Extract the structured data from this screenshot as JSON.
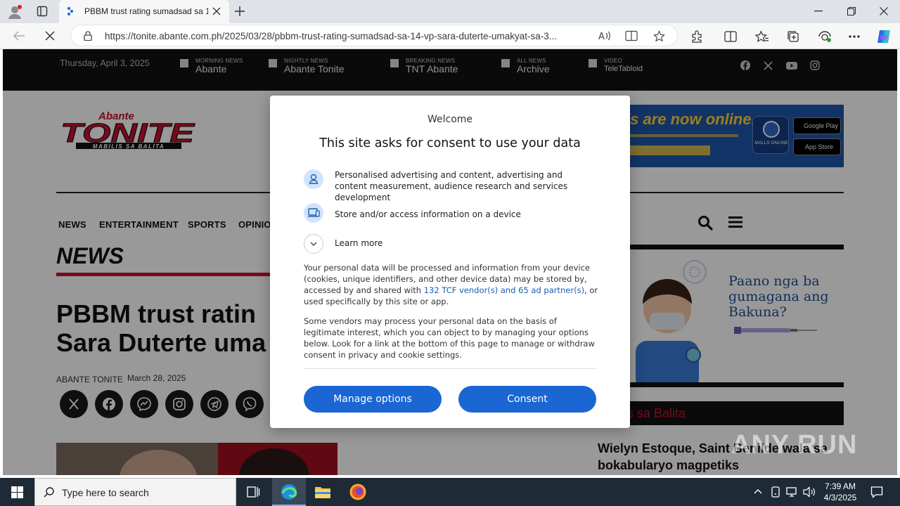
{
  "browser": {
    "tab_title": "PBBM trust rating sumadsad sa 1",
    "url": "https://tonite.abante.com.ph/2025/03/28/pbbm-trust-rating-sumadsad-sa-14-vp-sara-duterte-umakyat-sa-3..."
  },
  "site": {
    "date": "Thursday, April 3, 2025",
    "topnav": [
      {
        "small": "MORNING NEWS",
        "big": "Abante"
      },
      {
        "small": "NIGHTLY NEWS",
        "big": "Abante Tonite"
      },
      {
        "small": "BREAKING NEWS",
        "big": "TNT Abante"
      },
      {
        "small": "ALL NEWS",
        "big": "Archive"
      },
      {
        "small": "VIDEO",
        "big": "TeleTabloid"
      }
    ],
    "logo": {
      "top": "Abante",
      "main": "TONITE",
      "tagline": "MABILIS SA BALITA"
    },
    "banner_top_text": "ls are now online.",
    "banner_top_badge": "MALLS ONLINE",
    "store1": "Google Play",
    "store2": "App Store",
    "nav": [
      "NEWS",
      "ENTERTAINMENT",
      "SPORTS",
      "OPINIO"
    ],
    "section": "NEWS",
    "headline_line1": "PBBM trust ratin",
    "headline_line2": "Sara Duterte uma",
    "author": "ABANTE TONITE",
    "article_date": "March 28, 2025",
    "side_banner_text": "Paano nga ba gumagana ang Bakuna?",
    "side_bar_text": "lis sa Balita",
    "side_headline": "Wielyn Estoque, Saint Benilde wala sa bokabularyo magpetiks"
  },
  "consent": {
    "welcome": "Welcome",
    "title": "This site asks for consent to use your data",
    "purpose1": "Personalised advertising and content, advertising and content measurement, audience research and services development",
    "purpose2": "Store and/or access information on a device",
    "learn_more": "Learn more",
    "para1_a": "Your personal data will be processed and information from your device (cookies, unique identifiers, and other device data) may be stored by, accessed by and shared with ",
    "para1_link": "132 TCF vendor(s) and 65 ad partner(s)",
    "para1_b": ", or used specifically by this site or app.",
    "para2": "Some vendors may process your personal data on the basis of legitimate interest, which you can object to by managing your options below. Look for a link at the bottom of this page to manage or withdraw consent in privacy and cookie settings.",
    "manage_label": "Manage options",
    "consent_label": "Consent"
  },
  "watermark": "ANY RUN",
  "taskbar": {
    "search_placeholder": "Type here to search",
    "time": "7:39 AM",
    "date": "4/3/2025"
  },
  "colors": {
    "accent": "#1a66d2",
    "brand_red": "#c8102e",
    "link": "#1a5fb4"
  }
}
